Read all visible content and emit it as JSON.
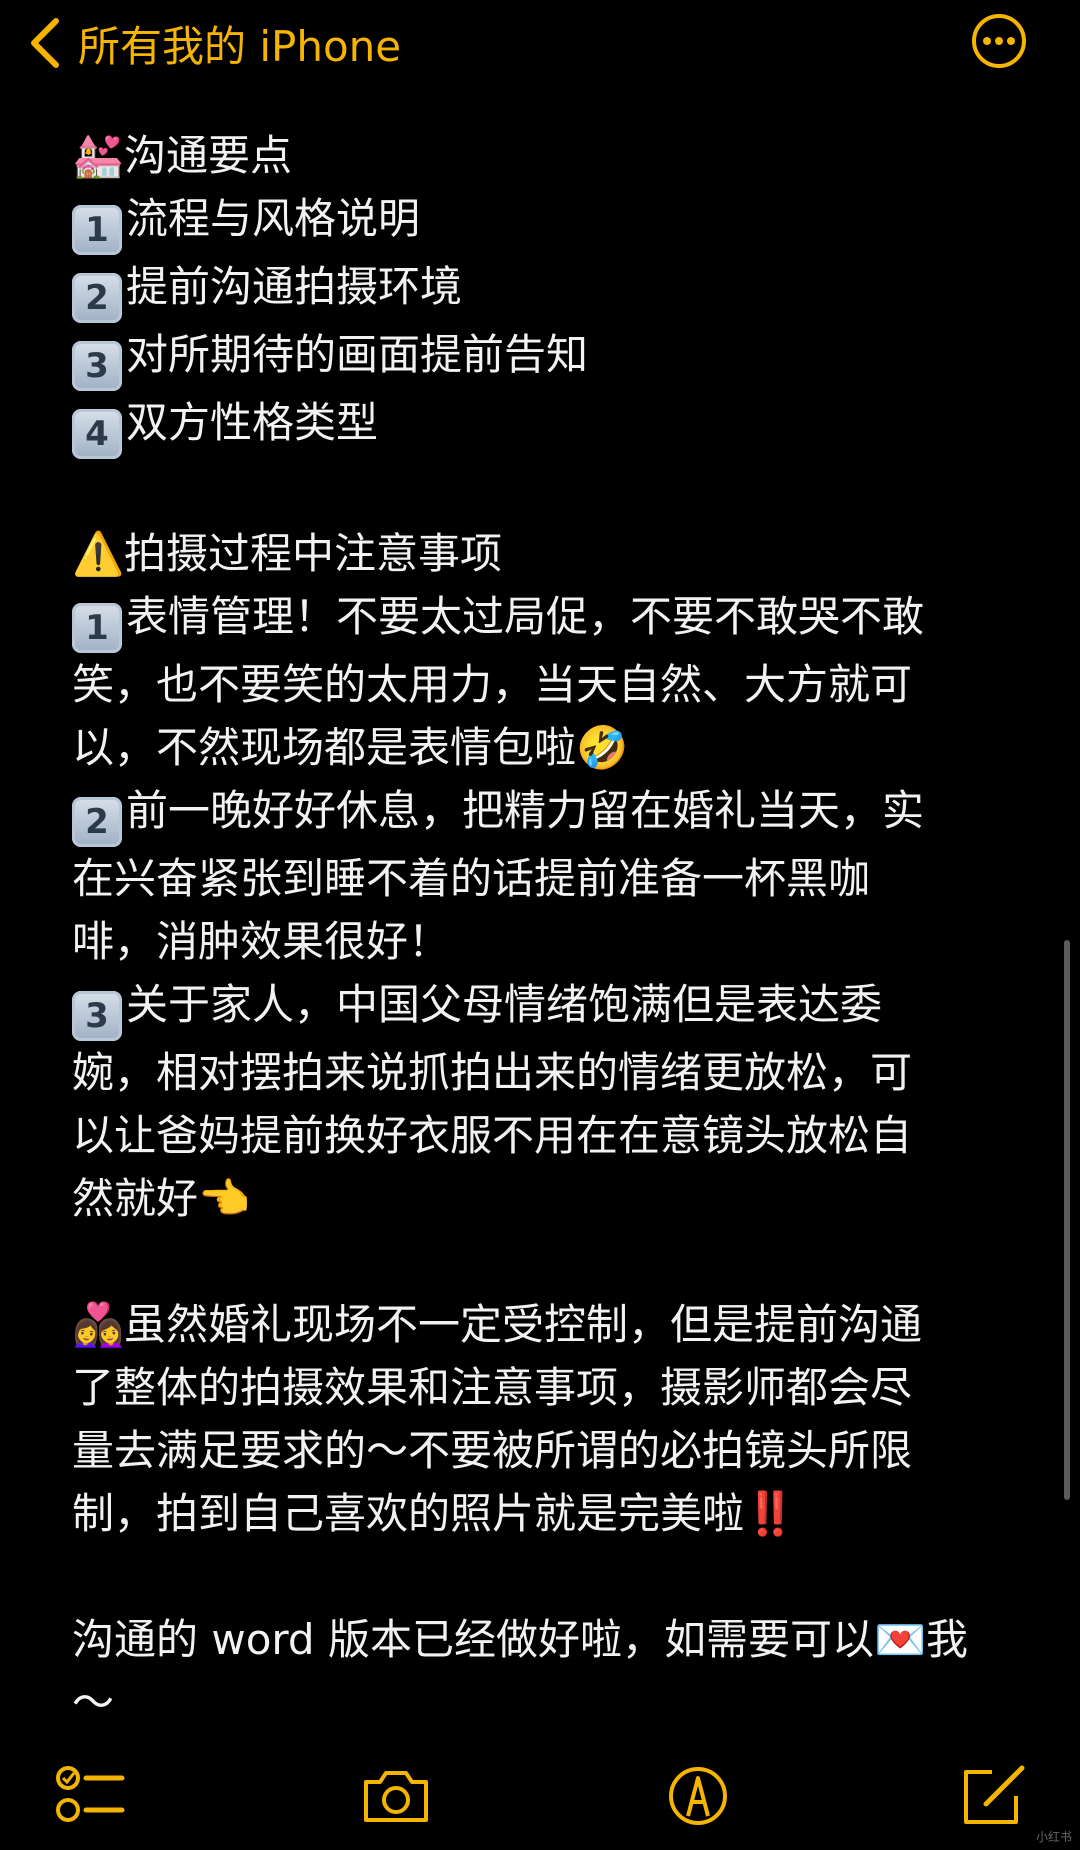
{
  "header": {
    "back_label": "所有我的 iPhone",
    "accent_color": "#f5b400",
    "icons": {
      "back": "chevron-left-icon",
      "more": "ellipsis-circle-icon"
    }
  },
  "note": {
    "section1_title": "沟通要点",
    "section1_items": [
      "流程与风格说明",
      "提前沟通拍摄环境",
      "对所期待的画面提前告知",
      "双方性格类型"
    ],
    "section2_title": "拍摄过程中注意事项",
    "section2_item1_lines": [
      "表情管理！不要太过局促，不要不敢哭不敢",
      "笑，也不要笑的太用力，当天自然、大方就可",
      "以，不然现场都是表情包啦"
    ],
    "section2_item2_lines": [
      "前一晚好好休息，把精力留在婚礼当天，实",
      "在兴奋紧张到睡不着的话提前准备一杯黑咖",
      "啡，消肿效果很好！"
    ],
    "section2_item3_lines": [
      "关于家人，中国父母情绪饱满但是表达委",
      "婉，相对摆拍来说抓拍出来的情绪更放松，可",
      "以让爸妈提前换好衣服不用在在意镜头放松自",
      "然就好"
    ],
    "closing_lines": [
      "虽然婚礼现场不一定受控制，但是提前沟通",
      "了整体的拍摄效果和注意事项，摄影师都会尽",
      "量去满足要求的～不要被所谓的必拍镜头所限",
      "制，拍到自己喜欢的照片就是完美啦"
    ],
    "final_line1": "沟通的 word 版本已经做好啦，如需要可以",
    "final_line1_end": "我",
    "final_line2": "～"
  },
  "emojis": {
    "chapel": "💒",
    "warning": "⚠️",
    "laugh": "🤣",
    "point": "👈",
    "couple": "👩‍❤️‍👩",
    "bang": "‼️",
    "envelope": "💌",
    "keycaps": [
      "1",
      "2",
      "3",
      "4"
    ]
  },
  "toolbar": {
    "icons": [
      "checklist-icon",
      "camera-icon",
      "markup-pen-icon",
      "compose-icon"
    ]
  },
  "watermark": "小红书"
}
